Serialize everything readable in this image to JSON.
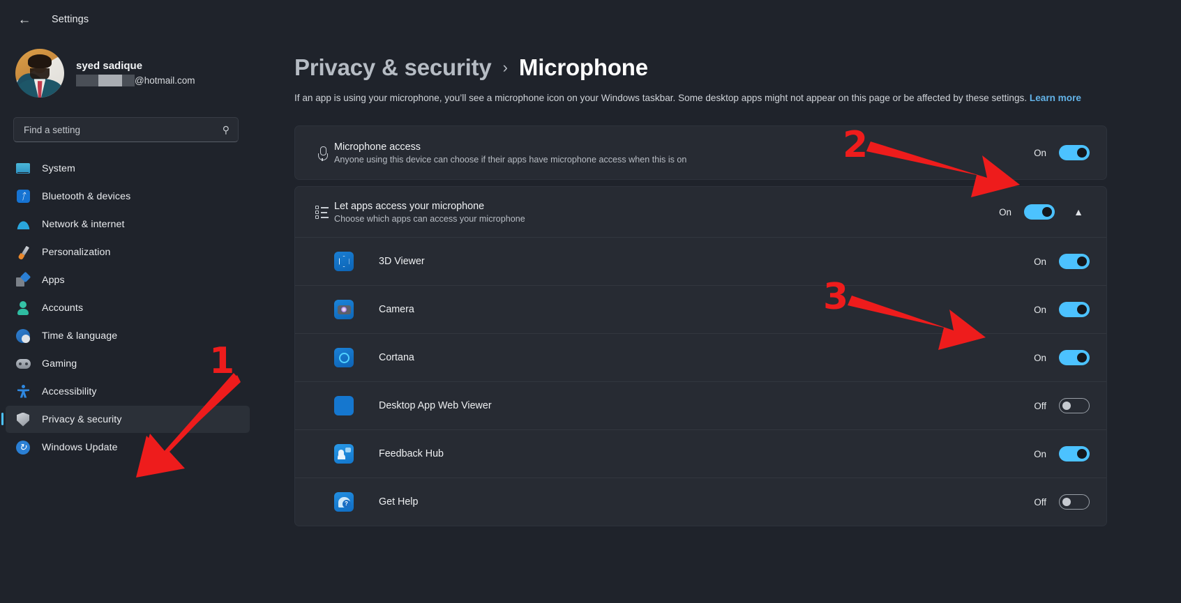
{
  "window": {
    "back_label": "Back",
    "title": "Settings"
  },
  "account": {
    "name": "syed sadique",
    "email_suffix": "@hotmail.com"
  },
  "search": {
    "placeholder": "Find a setting",
    "value": "",
    "icon": "search-icon"
  },
  "sidebar": {
    "items": [
      {
        "label": "System",
        "icon": "system-icon",
        "active": false
      },
      {
        "label": "Bluetooth & devices",
        "icon": "bluetooth-icon",
        "active": false
      },
      {
        "label": "Network & internet",
        "icon": "network-icon",
        "active": false
      },
      {
        "label": "Personalization",
        "icon": "paintbrush-icon",
        "active": false
      },
      {
        "label": "Apps",
        "icon": "apps-icon",
        "active": false
      },
      {
        "label": "Accounts",
        "icon": "accounts-icon",
        "active": false
      },
      {
        "label": "Time & language",
        "icon": "clock-icon",
        "active": false
      },
      {
        "label": "Gaming",
        "icon": "gamepad-icon",
        "active": false
      },
      {
        "label": "Accessibility",
        "icon": "accessibility-icon",
        "active": false
      },
      {
        "label": "Privacy & security",
        "icon": "shield-icon",
        "active": true
      },
      {
        "label": "Windows Update",
        "icon": "update-icon",
        "active": false
      }
    ]
  },
  "page": {
    "breadcrumb_parent": "Privacy & security",
    "breadcrumb_separator": "›",
    "breadcrumb_current": "Microphone",
    "description": "If an app is using your microphone, you’ll see a microphone icon on your Windows taskbar. Some desktop apps might not appear on this page or be affected by these settings.",
    "learn_more": "Learn more"
  },
  "microphone_access": {
    "title": "Microphone access",
    "subtitle": "Anyone using this device can choose if their apps have microphone access when this is on",
    "state": "On",
    "icon": "microphone-icon"
  },
  "let_apps": {
    "title": "Let apps access your microphone",
    "subtitle": "Choose which apps can access your microphone",
    "state": "On",
    "icon": "app-list-icon",
    "expanded": true,
    "chevron": "chevron-up-icon"
  },
  "apps": [
    {
      "name": "3D Viewer",
      "state": "On",
      "icon": "app-icon-3d-viewer"
    },
    {
      "name": "Camera",
      "state": "On",
      "icon": "app-icon-camera"
    },
    {
      "name": "Cortana",
      "state": "On",
      "icon": "app-icon-cortana"
    },
    {
      "name": "Desktop App Web Viewer",
      "state": "Off",
      "icon": "app-icon-desktop-app-web-viewer"
    },
    {
      "name": "Feedback Hub",
      "state": "On",
      "icon": "app-icon-feedback-hub"
    },
    {
      "name": "Get Help",
      "state": "Off",
      "icon": "app-icon-get-help"
    }
  ],
  "annotations": {
    "color": "#ee1c1c",
    "outline": "#ffffff",
    "steps": [
      {
        "number": "1",
        "points_to": "sidebar-item-privacy-security"
      },
      {
        "number": "2",
        "points_to": "microphone-access-toggle"
      },
      {
        "number": "3",
        "points_to": "camera-app-toggle"
      }
    ]
  },
  "colors": {
    "accent": "#4cc2ff",
    "link": "#63b3e8",
    "background": "#1f232b",
    "card": "#272b33"
  }
}
